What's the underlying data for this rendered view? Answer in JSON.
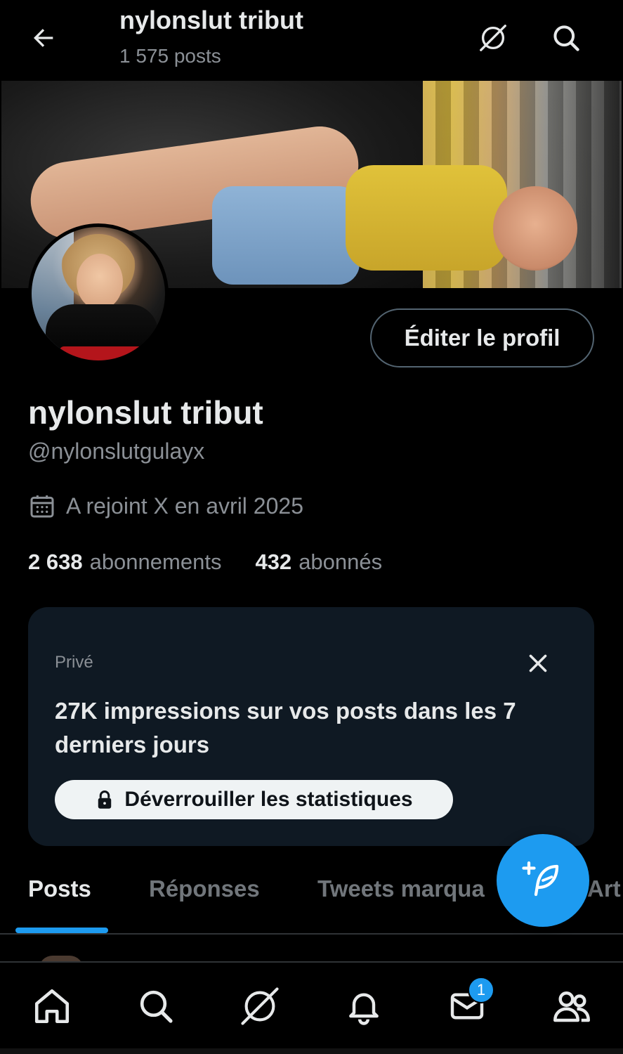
{
  "header": {
    "title": "nylonslut tribut",
    "subtitle": "1 575 posts"
  },
  "profile": {
    "display_name": "nylonslut tribut",
    "handle": "@nylonslutgulayx",
    "joined": "A rejoint X en avril 2025",
    "edit_button": "Éditer le profil",
    "following_count": "2 638",
    "following_label": "abonnements",
    "followers_count": "432",
    "followers_label": "abonnés"
  },
  "stats_card": {
    "label": "Privé",
    "text": "27K impressions sur vos posts dans les 7 derniers jours",
    "unlock_button": "Déverrouiller les statistiques"
  },
  "tabs": [
    {
      "label": "Posts",
      "active": true
    },
    {
      "label": "Réponses",
      "active": false
    },
    {
      "label": "Tweets marqua",
      "active": false
    },
    {
      "label": "Art",
      "active": false
    }
  ],
  "bottom_nav": {
    "items": [
      "home-icon",
      "search-icon",
      "grok-icon",
      "bell-icon",
      "mail-icon",
      "communities-icon"
    ],
    "messages_badge": "1"
  },
  "colors": {
    "background": "#000000",
    "accent": "#1d9bf0",
    "text_primary": "#e7e9ea",
    "text_secondary": "#8b9096",
    "card_background": "#0f1923"
  }
}
